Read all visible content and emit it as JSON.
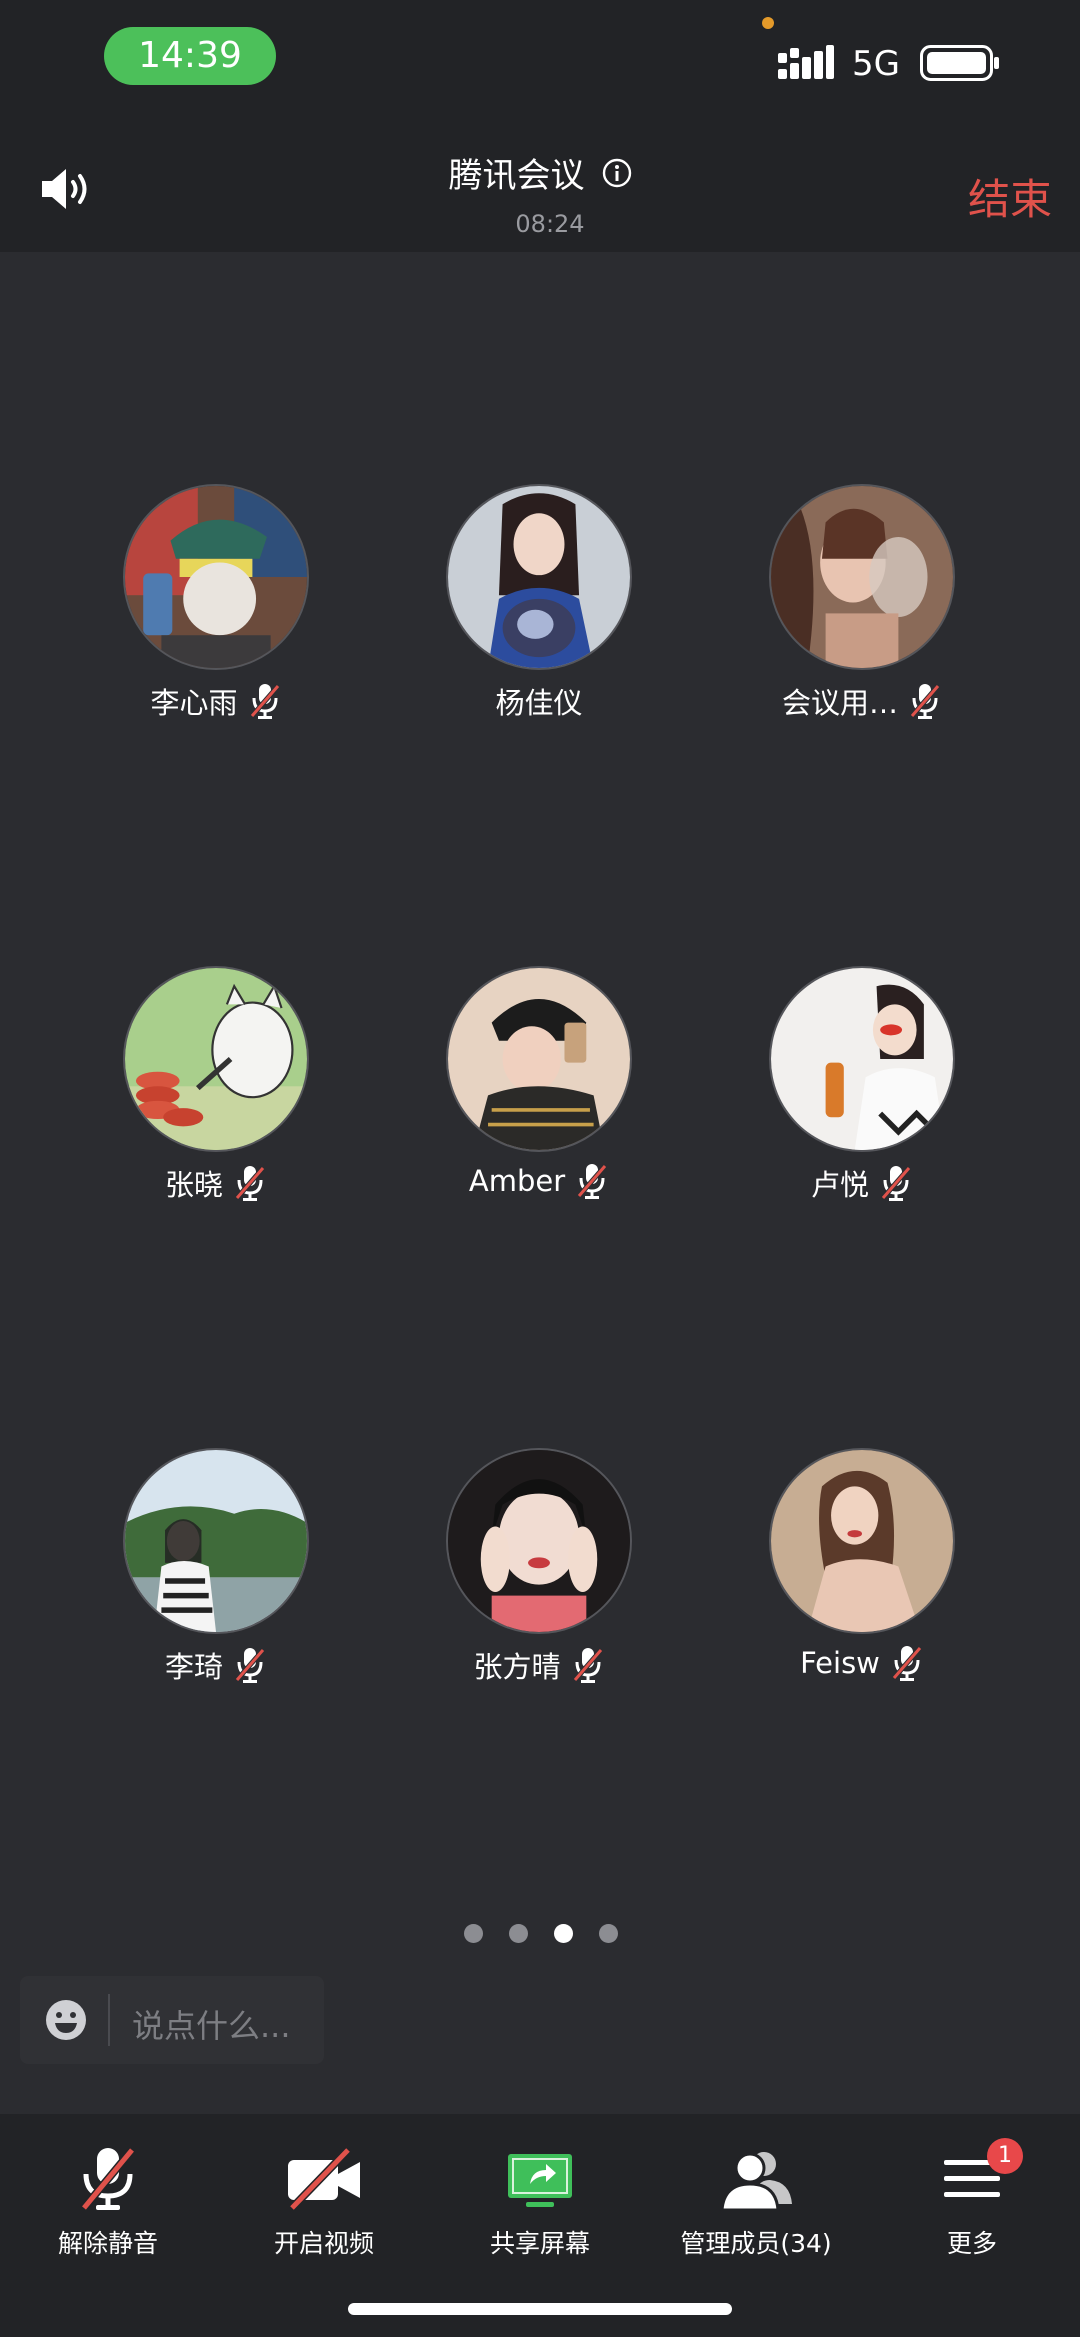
{
  "status_bar": {
    "time": "14:39",
    "network": "5G"
  },
  "header": {
    "title": "腾讯会议",
    "timer": "08:24",
    "end_label": "结束"
  },
  "participants": [
    {
      "name": "李心雨",
      "muted": true
    },
    {
      "name": "杨佳仪",
      "muted": false
    },
    {
      "name": "会议用…",
      "muted": true
    },
    {
      "name": "张晓",
      "muted": true
    },
    {
      "name": "Amber",
      "muted": true
    },
    {
      "name": "卢悦",
      "muted": true
    },
    {
      "name": "李琦",
      "muted": true
    },
    {
      "name": "张方晴",
      "muted": true
    },
    {
      "name": "Feisw",
      "muted": true
    }
  ],
  "pager": {
    "total": 4,
    "active": 3
  },
  "chat": {
    "placeholder": "说点什么..."
  },
  "toolbar": {
    "unmute_label": "解除静音",
    "video_label": "开启视频",
    "share_label": "共享屏幕",
    "members_label": "管理成员(34)",
    "more_label": "更多",
    "more_badge": "1"
  },
  "colors": {
    "end": "#e0524b",
    "time_pill": "#4cc05a",
    "share_green": "#3fbf5a",
    "mute_red": "#e0524b",
    "badge": "#e8484a"
  }
}
